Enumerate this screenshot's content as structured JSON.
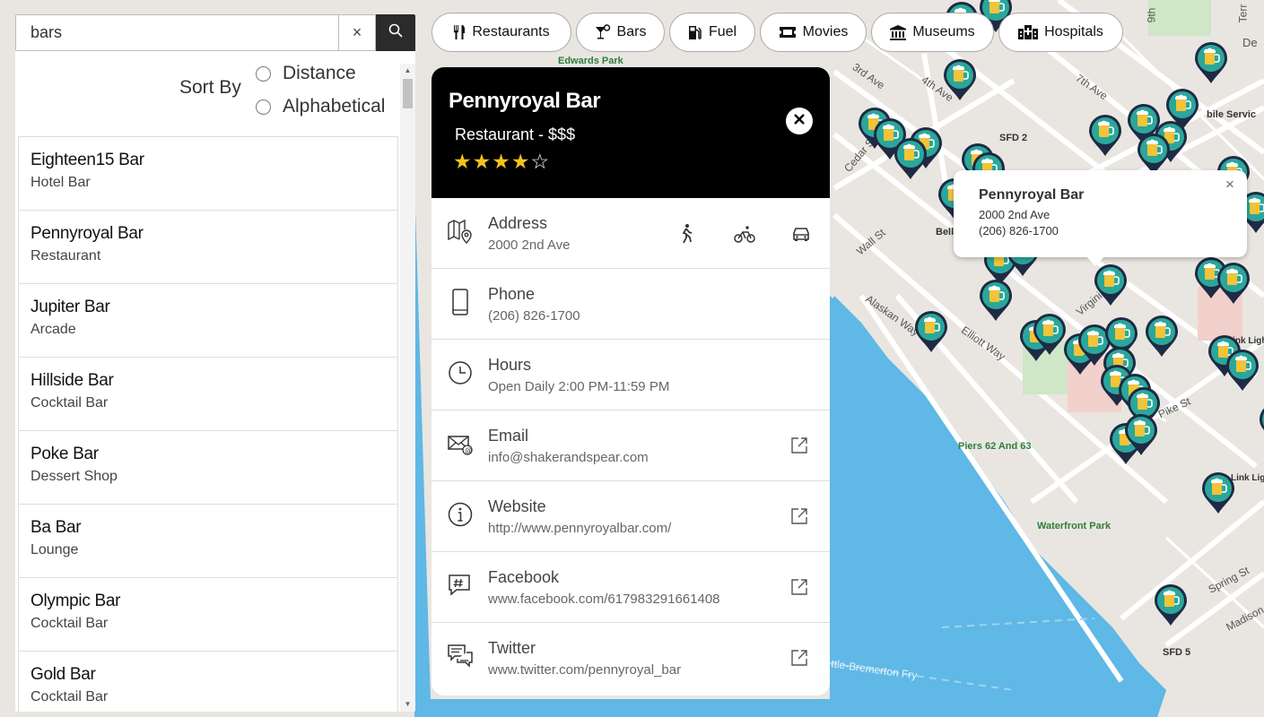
{
  "search": {
    "value": "bars",
    "placeholder": "",
    "clear_icon": "×",
    "search_icon": "search-icon"
  },
  "sort": {
    "label": "Sort By",
    "options": [
      "Distance",
      "Alphabetical"
    ]
  },
  "results": [
    {
      "name": "Eighteen15 Bar",
      "type": "Hotel Bar"
    },
    {
      "name": "Pennyroyal Bar",
      "type": "Restaurant"
    },
    {
      "name": "Jupiter Bar",
      "type": "Arcade"
    },
    {
      "name": "Hillside Bar",
      "type": "Cocktail Bar"
    },
    {
      "name": "Poke Bar",
      "type": "Dessert Shop"
    },
    {
      "name": "Ba Bar",
      "type": "Lounge"
    },
    {
      "name": "Olympic Bar",
      "type": "Cocktail Bar"
    },
    {
      "name": "Gold Bar",
      "type": "Cocktail Bar"
    }
  ],
  "categories": [
    {
      "label": "Restaurants",
      "icon": "fork-knife-icon"
    },
    {
      "label": "Bars",
      "icon": "cocktail-icon"
    },
    {
      "label": "Fuel",
      "icon": "fuel-pump-icon"
    },
    {
      "label": "Movies",
      "icon": "ticket-icon"
    },
    {
      "label": "Museums",
      "icon": "museum-icon"
    },
    {
      "label": "Hospitals",
      "icon": "hospital-icon"
    }
  ],
  "detail": {
    "title": "Pennyroyal Bar",
    "subtitle": "Restaurant - $$$",
    "rating": 4,
    "rating_max": 5,
    "star_filled": "★",
    "star_empty": "☆",
    "accent": "#f2c318",
    "rows": [
      {
        "label": "Address",
        "value": "2000 2nd Ave",
        "icon": "map-pin-icon"
      },
      {
        "label": "Phone",
        "value": "(206) 826-1700",
        "icon": "phone-icon"
      },
      {
        "label": "Hours",
        "value": "Open Daily 2:00 PM-11:59 PM",
        "icon": "clock-icon"
      },
      {
        "label": "Email",
        "value": "info@shakerandspear.com",
        "icon": "email-icon"
      },
      {
        "label": "Website",
        "value": "http://www.pennyroyalbar.com/",
        "icon": "info-icon"
      },
      {
        "label": "Facebook",
        "value": "www.facebook.com/617983291661408",
        "icon": "hashtag-icon"
      },
      {
        "label": "Twitter",
        "value": "www.twitter.com/pennyroyal_bar",
        "icon": "chat-icon"
      }
    ]
  },
  "popup": {
    "title": "Pennyroyal Bar",
    "address": "2000 2nd Ave",
    "phone": "(206) 826-1700",
    "close": "×"
  },
  "map": {
    "labels": [
      "Edwards Park",
      "3rd Ave",
      "4th Ave",
      "7th Ave",
      "SFD 2",
      "Wall St",
      "Alaskan Way",
      "Elliott Way",
      "Virginia St",
      "Pike St",
      "Piers 62 And 63",
      "Waterfront Park",
      "Spring St",
      "Madison",
      "SFD 5",
      "ttle-Bremerton Fry",
      "Link Light Rail Westlake",
      "Link Light Rail University Street",
      "bile Servic",
      "Cedar St",
      "Bell",
      "9th",
      "Terr",
      "De"
    ],
    "pin_color": "#2aa79b",
    "pin_ring": "#1f2a44",
    "water_color": "#5fb8e6"
  }
}
